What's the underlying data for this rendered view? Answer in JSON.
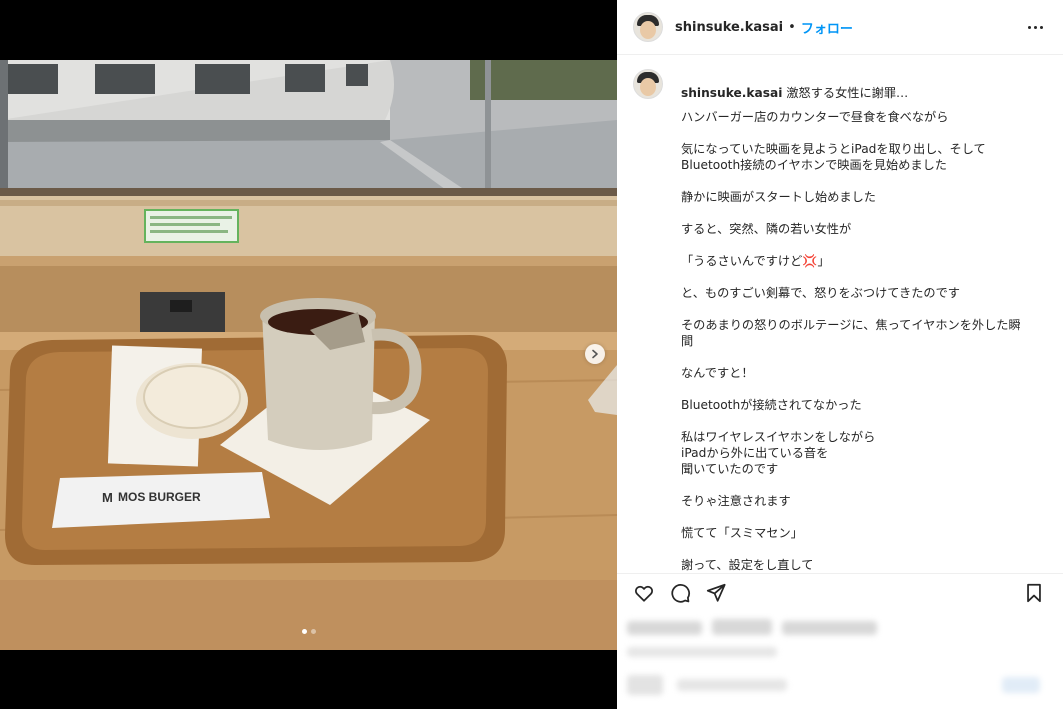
{
  "post": {
    "username": "shinsuke.kasai",
    "separator": "•",
    "follow_label": "フォロー",
    "more_icon": "more-horizontal-icon"
  },
  "media": {
    "brand_text": "MOS BURGER",
    "carousel": {
      "count": 2,
      "active_index": 0
    },
    "next_icon": "chevron-right-icon"
  },
  "caption": {
    "username": "shinsuke.kasai",
    "title": "激怒する女性に謝罪…",
    "paragraphs": [
      "ハンバーガー店のカウンターで昼食を食べながら",
      "気になっていた映画を見ようとiPadを取り出し、そして\nBluetooth接続のイヤホンで映画を見始めました",
      "静かに映画がスタートし始めました",
      "すると、突然、隣の若い女性が",
      "「うるさいんですけど💢」",
      "と、ものすごい剣幕で、怒りをぶつけてきたのです",
      "そのあまりの怒りのボルテージに、焦ってイヤホンを外した瞬\n間",
      "なんですと！",
      "Bluetoothが接続されてなかった",
      "私はワイヤレスイヤホンをしながら\niPadから外に出ている音を\n聞いていたのです",
      "そりゃ注意されます",
      "慌てて「スミマセン」",
      "謝って、設定をし直して"
    ]
  },
  "actions": {
    "like_icon": "heart-icon",
    "comment_icon": "comment-icon",
    "share_icon": "send-icon",
    "save_icon": "bookmark-icon"
  }
}
